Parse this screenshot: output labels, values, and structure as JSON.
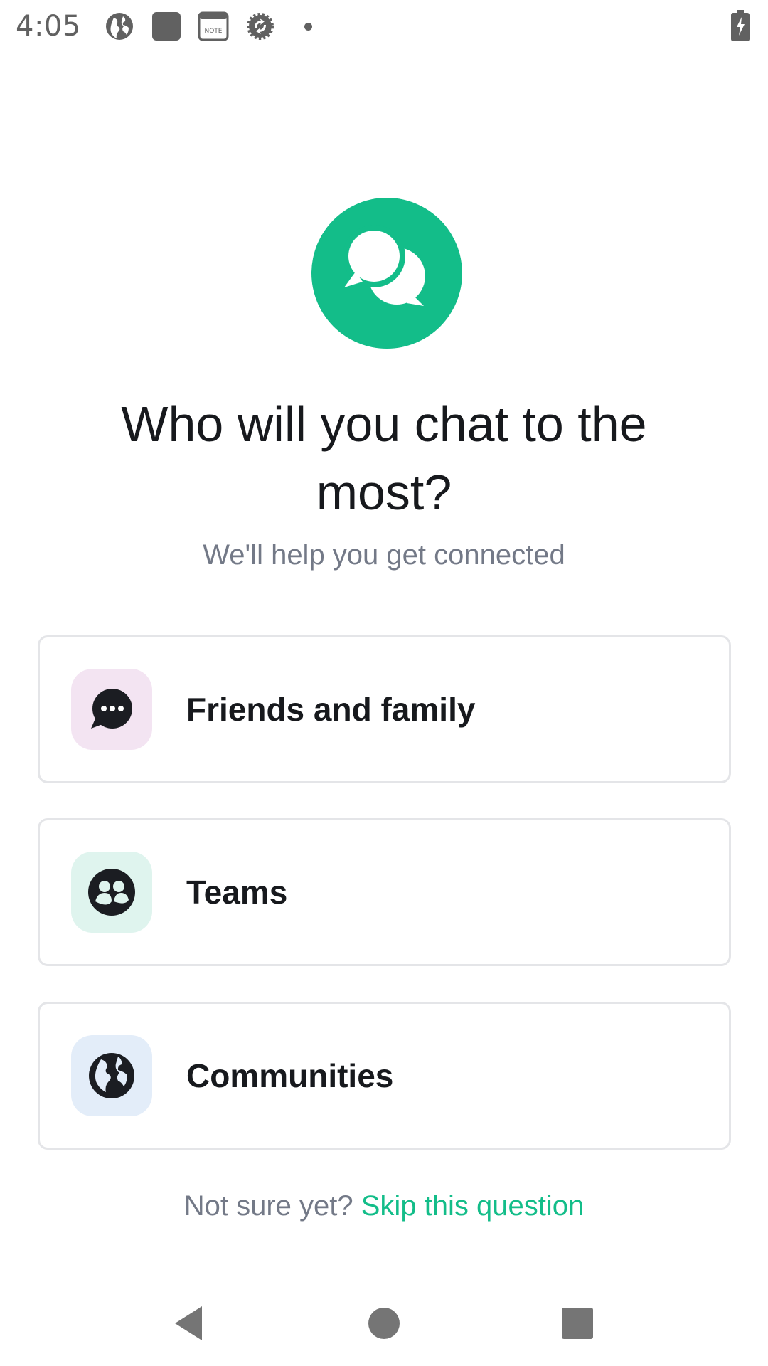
{
  "status_bar": {
    "time": "4:05",
    "icons": [
      "globe-icon",
      "square-app-icon",
      "note-icon",
      "sync-icon",
      "dot-icon"
    ],
    "note_text": "NOTE",
    "battery": "battery-charging-icon"
  },
  "hero": {
    "logo": "chat-bubbles-icon",
    "brand_color": "#13bd89",
    "title": "Who will you chat to the most?",
    "subtitle": "We'll help you get connected"
  },
  "options": [
    {
      "label": "Friends and family",
      "icon": "chat-dots-icon",
      "icon_bg": "#f3e4f2"
    },
    {
      "label": "Teams",
      "icon": "group-icon",
      "icon_bg": "#dff4ee"
    },
    {
      "label": "Communities",
      "icon": "globe-icon",
      "icon_bg": "#e3edf9"
    }
  ],
  "footer": {
    "prompt": "Not sure yet?",
    "skip_label": "Skip this question"
  },
  "nav": {
    "back": "back-icon",
    "home": "home-icon",
    "recents": "recents-icon"
  }
}
